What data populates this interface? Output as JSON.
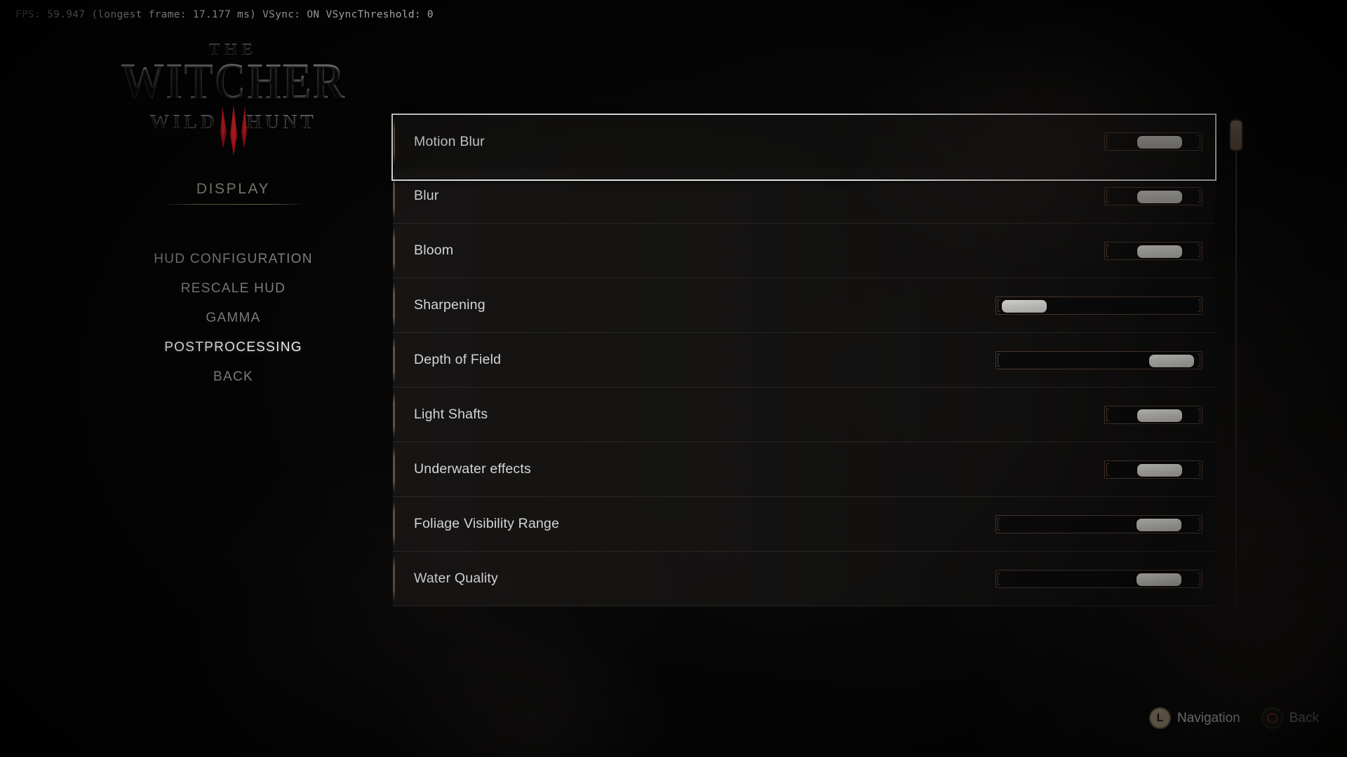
{
  "overlay": {
    "fps_text": "FPS: 59.947 (longest frame: 17.177 ms) VSync: ON VSyncThreshold: 0"
  },
  "logo": {
    "line1": "THE",
    "line2": "WITCHER",
    "trademark": "®",
    "line3_left": "WILD",
    "line3_right": "HUNT",
    "claw_color": "#c4161c"
  },
  "sidebar": {
    "section_title": "DISPLAY",
    "items": [
      {
        "label": "HUD CONFIGURATION",
        "selected": false
      },
      {
        "label": "RESCALE HUD",
        "selected": false
      },
      {
        "label": "GAMMA",
        "selected": false
      },
      {
        "label": "POSTPROCESSING",
        "selected": true
      },
      {
        "label": "BACK",
        "selected": false
      }
    ]
  },
  "settings": {
    "rows": [
      {
        "label": "Motion Blur",
        "value": "On",
        "track": "narrow",
        "knob_pos": 0.62,
        "selected": true
      },
      {
        "label": "Blur",
        "value": "On",
        "track": "narrow",
        "knob_pos": 0.62,
        "selected": false
      },
      {
        "label": "Bloom",
        "value": "On",
        "track": "narrow",
        "knob_pos": 0.62,
        "selected": false
      },
      {
        "label": "Sharpening",
        "value": "Off",
        "track": "wide",
        "knob_pos": 0.02,
        "selected": false
      },
      {
        "label": "Depth of Field",
        "value": "On",
        "track": "wide",
        "knob_pos": 0.96,
        "selected": false
      },
      {
        "label": "Light Shafts",
        "value": "On",
        "track": "narrow",
        "knob_pos": 0.62,
        "selected": false
      },
      {
        "label": "Underwater effects",
        "value": "On",
        "track": "narrow",
        "knob_pos": 0.62,
        "selected": false
      },
      {
        "label": "Foliage Visibility Range",
        "value": "Ultra",
        "track": "wide",
        "knob_pos": 0.88,
        "selected": false
      },
      {
        "label": "Water Quality",
        "value": "High",
        "track": "wide",
        "knob_pos": 0.88,
        "selected": false
      }
    ]
  },
  "scrollbar": {
    "thumb_position": "top"
  },
  "hints": [
    {
      "glyph": "L",
      "label": "Navigation",
      "type": "shoulder-button"
    },
    {
      "glyph": "circle",
      "label": "Back",
      "type": "circle-button"
    }
  ]
}
